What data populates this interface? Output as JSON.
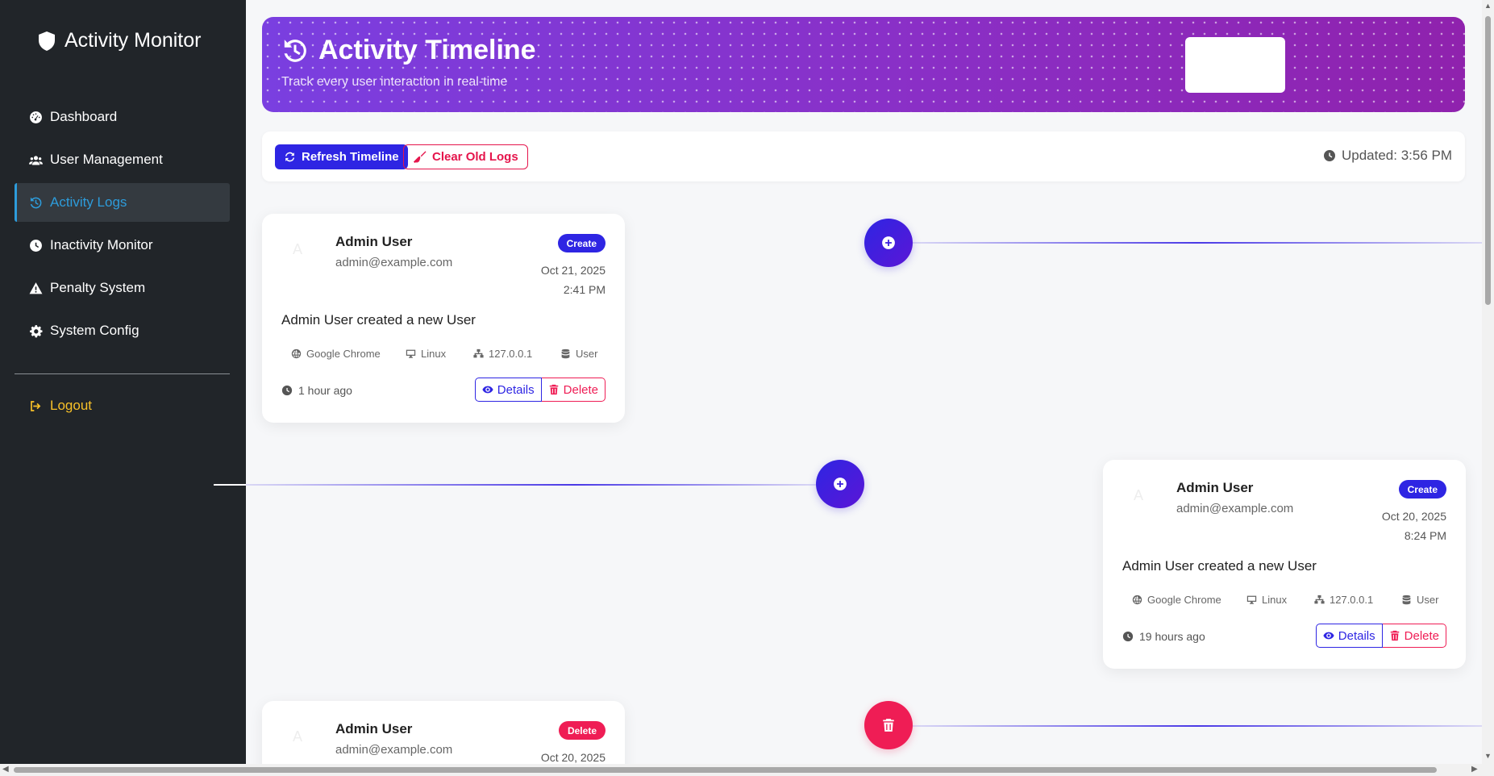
{
  "sidebar": {
    "brand": "Activity Monitor",
    "items": [
      {
        "label": "Dashboard",
        "icon": "gauge-icon"
      },
      {
        "label": "User Management",
        "icon": "users-icon"
      },
      {
        "label": "Activity Logs",
        "icon": "history-icon",
        "active": true
      },
      {
        "label": "Inactivity Monitor",
        "icon": "clock-icon"
      },
      {
        "label": "Penalty System",
        "icon": "warning-icon"
      },
      {
        "label": "System Config",
        "icon": "gear-icon"
      }
    ],
    "logout": "Logout"
  },
  "hero": {
    "title": "Activity Timeline",
    "subtitle": "Track every user interaction in real-time"
  },
  "toolbar": {
    "refresh_label": "Refresh Timeline",
    "clear_label": "Clear Old Logs",
    "updated": "Updated: 3:56 PM"
  },
  "timeline": [
    {
      "name": "Admin User",
      "email": "admin@example.com",
      "avatar": "A",
      "badge": "Create",
      "type": "create",
      "date": "Oct 21, 2025",
      "time": "2:41 PM",
      "description": "Admin User created a new User",
      "browser": "Google Chrome",
      "os": "Linux",
      "ip": "127.0.0.1",
      "model": "User",
      "ago": "1 hour ago",
      "details_label": "Details",
      "delete_label": "Delete"
    },
    {
      "name": "Admin User",
      "email": "admin@example.com",
      "avatar": "A",
      "badge": "Create",
      "type": "create",
      "date": "Oct 20, 2025",
      "time": "8:24 PM",
      "description": "Admin User created a new User",
      "browser": "Google Chrome",
      "os": "Linux",
      "ip": "127.0.0.1",
      "model": "User",
      "ago": "19 hours ago",
      "details_label": "Details",
      "delete_label": "Delete"
    },
    {
      "name": "Admin User",
      "email": "admin@example.com",
      "avatar": "A",
      "badge": "Delete",
      "type": "delete",
      "date": "Oct 20, 2025"
    }
  ],
  "colors": {
    "sidebar_bg": "#212529",
    "active_link": "#2d9cdb",
    "logout": "#f7c028",
    "primary": "#2e25e3",
    "danger": "#ef1d55",
    "hero_gradient_start": "#7a3fe0",
    "hero_gradient_end": "#8f22ad"
  }
}
